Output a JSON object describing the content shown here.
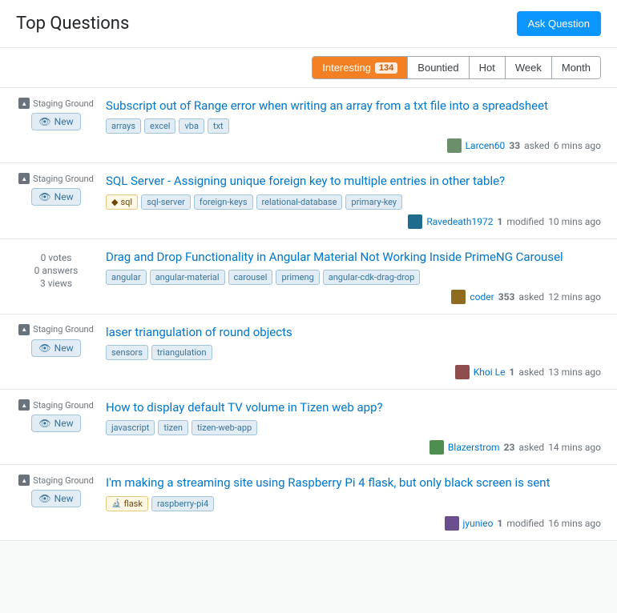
{
  "header": {
    "title": "Top Questions",
    "ask_button": "Ask Question"
  },
  "filters": {
    "tabs": [
      {
        "id": "interesting",
        "label": "Interesting",
        "count": "134",
        "active": true
      },
      {
        "id": "bountied",
        "label": "Bountied",
        "count": null,
        "active": false
      },
      {
        "id": "hot",
        "label": "Hot",
        "count": null,
        "active": false
      },
      {
        "id": "week",
        "label": "Week",
        "count": null,
        "active": false
      },
      {
        "id": "month",
        "label": "Month",
        "count": null,
        "active": false
      }
    ]
  },
  "questions": [
    {
      "id": 1,
      "type": "staging_ground",
      "staging_ground_label": "Staging Ground",
      "is_new": true,
      "new_label": "New",
      "title": "Subscript out of Range error when writing an array from a txt file into a spreadsheet",
      "tags": [
        "arrays",
        "excel",
        "vba",
        "txt"
      ],
      "featured_tags": [],
      "user": "Larcen60",
      "user_rep": "33",
      "action": "asked",
      "time": "6 mins ago",
      "action_type": "asked",
      "avatar_class": "avatar-larcen"
    },
    {
      "id": 2,
      "type": "staging_ground",
      "staging_ground_label": "Staging Ground",
      "is_new": true,
      "new_label": "New",
      "title": "SQL Server - Assigning unique foreign key to multiple entries in other table?",
      "tags": [
        "sql",
        "sql-server",
        "foreign-keys",
        "relational-database",
        "primary-key"
      ],
      "featured_tags": [],
      "user": "Ravedeath1972",
      "user_rep": "1",
      "action": "modified",
      "time": "10 mins ago",
      "action_type": "modified",
      "avatar_class": "avatar-ravedeath"
    },
    {
      "id": 3,
      "type": "regular",
      "votes": "0 votes",
      "answers": "0 answers",
      "views": "3 views",
      "title": "Drag and Drop Functionality in Angular Material Not Working Inside PrimeNG Carousel",
      "tags": [
        "angular",
        "angular-material",
        "carousel",
        "primeng",
        "angular-cdk-drag-drop"
      ],
      "featured_tags": [],
      "user": "coder",
      "user_rep": "353",
      "action": "asked",
      "time": "12 mins ago",
      "action_type": "asked",
      "avatar_class": "avatar-coder"
    },
    {
      "id": 4,
      "type": "staging_ground",
      "staging_ground_label": "Staging Ground",
      "is_new": true,
      "new_label": "New",
      "title": "laser triangulation of round objects",
      "tags": [
        "sensors",
        "triangulation"
      ],
      "featured_tags": [],
      "user": "Khoi Le",
      "user_rep": "1",
      "action": "asked",
      "time": "13 mins ago",
      "action_type": "asked",
      "avatar_class": "avatar-khoi"
    },
    {
      "id": 5,
      "type": "staging_ground",
      "staging_ground_label": "Staging Ground",
      "is_new": true,
      "new_label": "New",
      "title": "How to display default TV volume in Tizen web app?",
      "tags": [
        "javascript",
        "tizen",
        "tizen-web-app"
      ],
      "featured_tags": [],
      "user": "Blazerstrom",
      "user_rep": "23",
      "action": "asked",
      "time": "14 mins ago",
      "action_type": "asked",
      "avatar_class": "avatar-blazer"
    },
    {
      "id": 6,
      "type": "staging_ground",
      "staging_ground_label": "Staging Ground",
      "is_new": true,
      "new_label": "New",
      "title": "I'm making a streaming site using Raspberry Pi 4 flask, but only black screen is sent",
      "tags": [
        "flask",
        "raspberry-pi4"
      ],
      "featured_tags": [
        "flask"
      ],
      "user": "jyunieo",
      "user_rep": "1",
      "action": "modified",
      "time": "16 mins ago",
      "action_type": "modified",
      "avatar_class": "avatar-jyunieo"
    }
  ]
}
